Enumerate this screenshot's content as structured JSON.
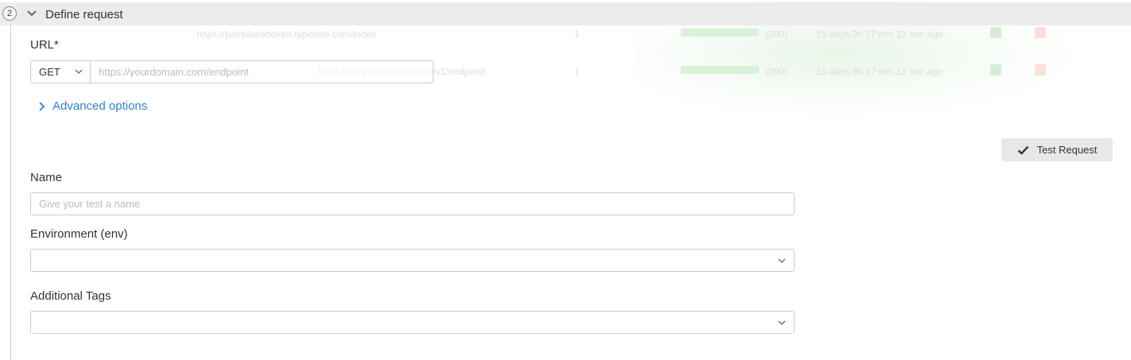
{
  "background_rows": [
    {
      "path": "https://jsonplaceholder.typicode.com/todos",
      "count": "1",
      "code": "(200)",
      "time": "15 days 3h 17 min 11 sec ago"
    },
    {
      "path": "https://api.yourdomain.com/v1/endpoint",
      "count": "1",
      "code": "(200)",
      "time": "15 days 3h 17 min 11 sec ago"
    }
  ],
  "step": {
    "number": "2",
    "title": "Define request"
  },
  "url": {
    "label": "URL*",
    "method": "GET",
    "placeholder": "https://yourdomain.com/endpoint"
  },
  "advanced_options_label": "Advanced options",
  "test_button_label": "Test Request",
  "name": {
    "label": "Name",
    "placeholder": "Give your test a name"
  },
  "environment": {
    "label": "Environment (env)",
    "value": ""
  },
  "tags": {
    "label": "Additional Tags",
    "value": ""
  },
  "colors": {
    "link": "#2f7fd3",
    "header_bg": "#ececec",
    "check": "#1f4d3a"
  }
}
